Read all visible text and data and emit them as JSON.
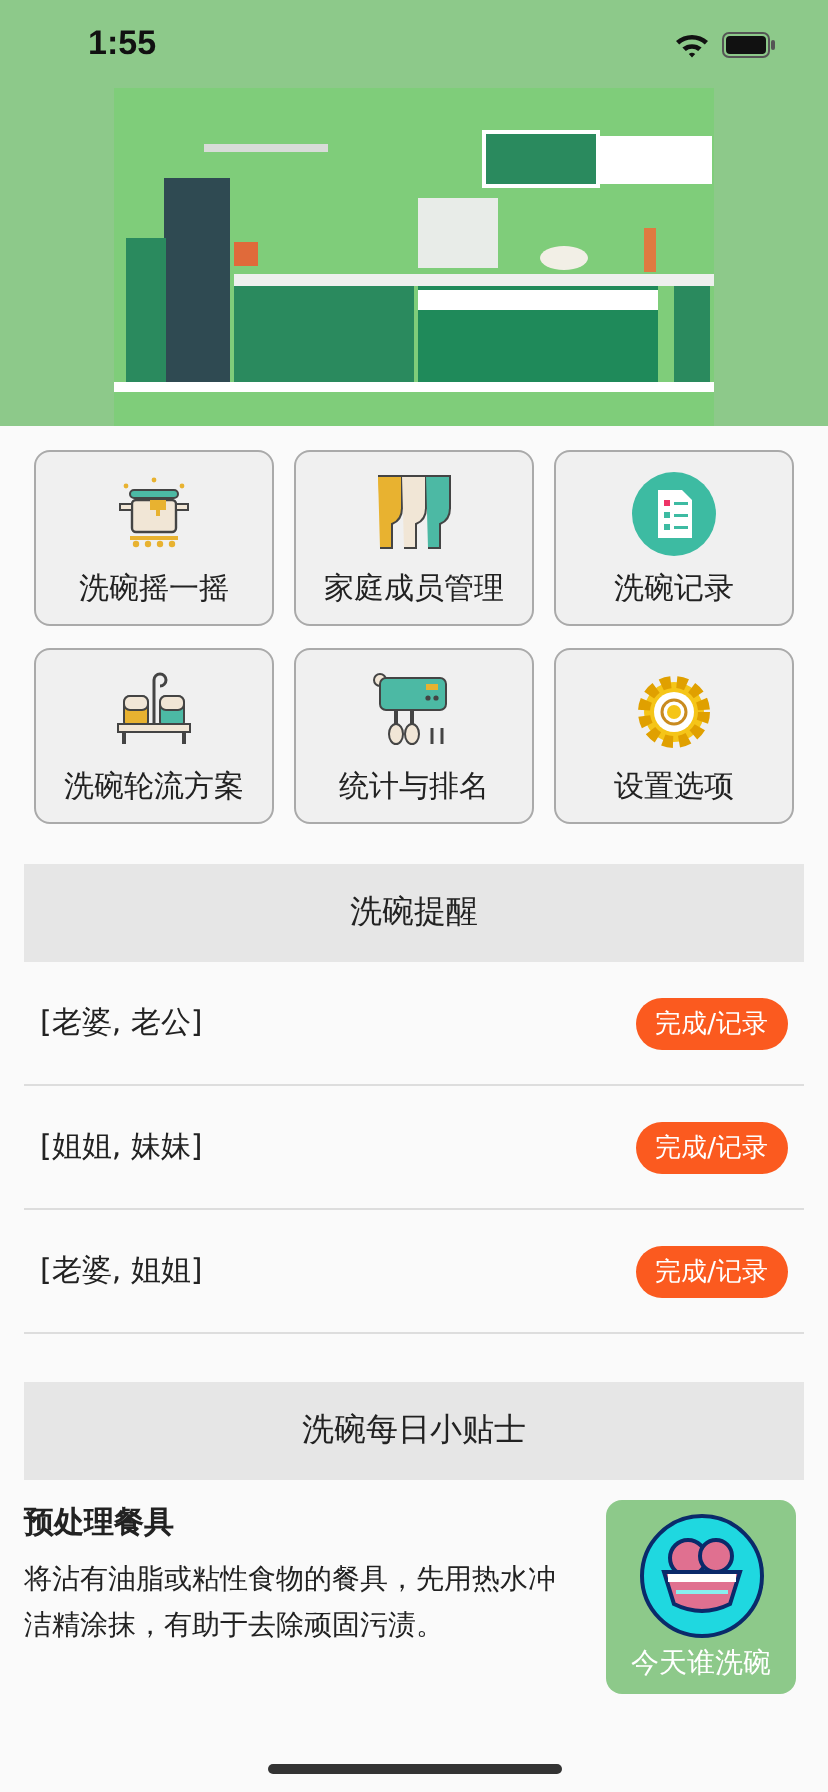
{
  "status_bar": {
    "time": "1:55"
  },
  "menu": [
    {
      "label": "洗碗摇一摇"
    },
    {
      "label": "家庭成员管理"
    },
    {
      "label": "洗碗记录"
    },
    {
      "label": "洗碗轮流方案"
    },
    {
      "label": "统计与排名"
    },
    {
      "label": "设置选项"
    }
  ],
  "reminders": {
    "title": "洗碗提醒",
    "items": [
      {
        "members": "[老婆, 老公]",
        "action": "完成/记录"
      },
      {
        "members": "[姐姐, 妹妹]",
        "action": "完成/记录"
      },
      {
        "members": "[老婆, 姐姐]",
        "action": "完成/记录"
      }
    ]
  },
  "tips": {
    "title": "洗碗每日小贴士",
    "tip_title": "预处理餐具",
    "lines": [
      "将沾有油脂或粘性食物的餐具，先用热水冲",
      "洁精涂抹，有助于去除顽固污渍。"
    ]
  },
  "float_button": {
    "label": "今天谁洗碗"
  }
}
